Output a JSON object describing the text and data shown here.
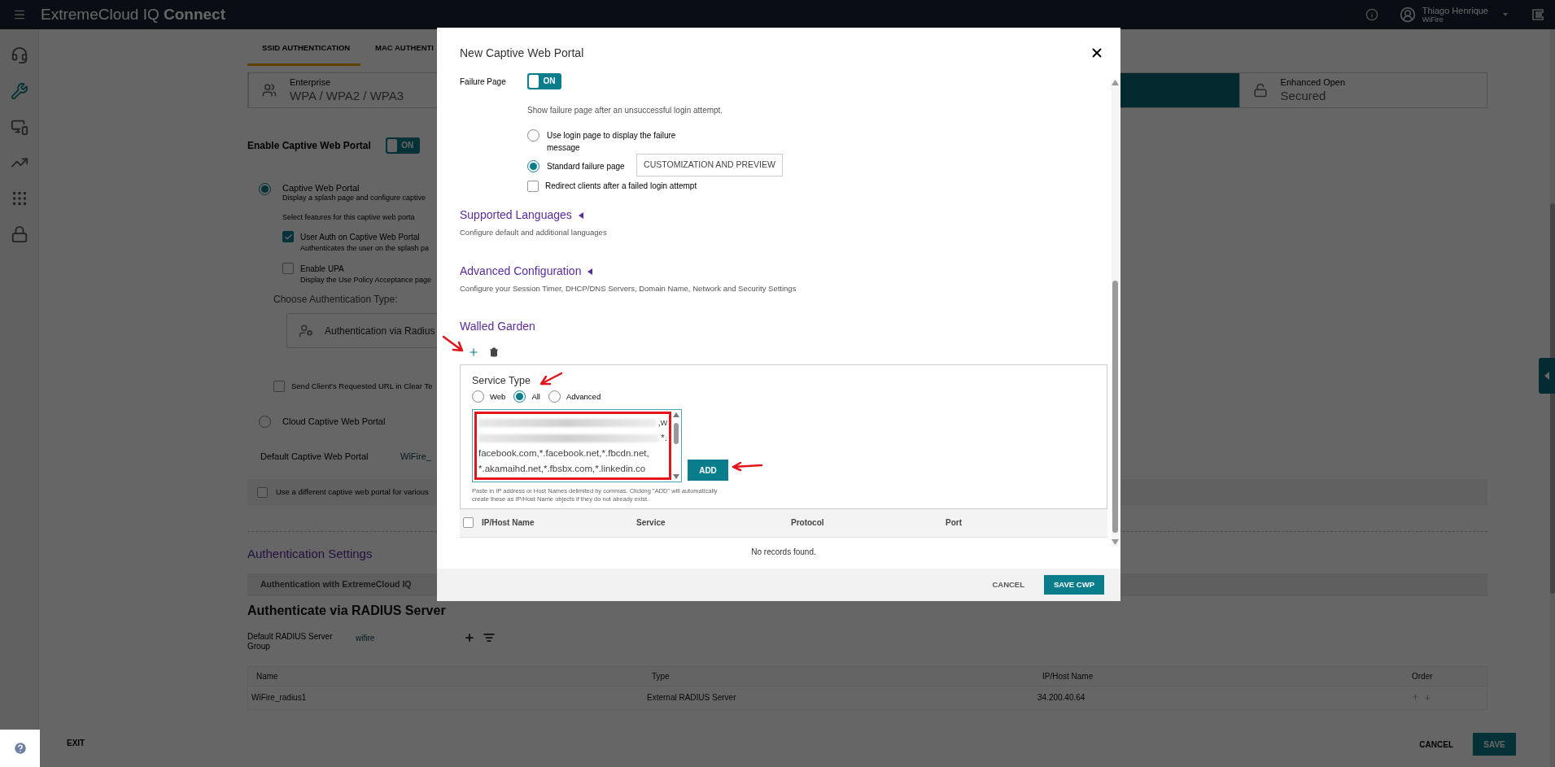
{
  "top_bar": {
    "brand": "ExtremeCloud IQ",
    "brand_bold": "Connect",
    "user_name": "Thiago Henrique",
    "user_org": "WiFire"
  },
  "sidebar": {
    "items": [
      {
        "selected": false
      },
      {
        "selected": true
      },
      {
        "selected": false
      },
      {
        "selected": false
      },
      {
        "selected": false
      },
      {
        "selected": false
      }
    ]
  },
  "tabs": [
    {
      "label": "SSID AUTHENTICATION",
      "selected": true
    },
    {
      "label": "MAC AUTHENTI",
      "selected": false
    }
  ],
  "auth_cards": [
    {
      "title": "Enterprise",
      "value": "WPA / WPA2 / WPA3",
      "selected": false
    },
    {
      "selected": true
    },
    {
      "title": "Enhanced Open",
      "value": "Secured",
      "selected": false
    }
  ],
  "captive_portal": {
    "label": "Enable Captive Web Portal",
    "toggle": {
      "label": "ON",
      "on": true
    },
    "portal_types": [
      {
        "label": "Captive Web Portal",
        "description": "Display a splash page and configure captive",
        "selected": true
      },
      {
        "label": "Cloud Captive Web Portal",
        "selected": false
      }
    ],
    "features_prompt": "Select features for this captive web porta",
    "features": [
      {
        "label": "User Auth on Captive Web Portal",
        "description": "Authenticates the user on the splash pa",
        "checked": true
      },
      {
        "label": "Enable UPA",
        "description": "Display the Use Policy Acceptance page",
        "checked": false
      }
    ],
    "auth_type_label": "Choose Authentication Type:",
    "auth_type_card": "Authentication via Radius",
    "send_url": {
      "label": "Send Client's Requested URL in Clear Te",
      "checked": false
    },
    "default_portal": {
      "label": "Default Captive Web Portal",
      "value": "WiFire_"
    },
    "different_portal": {
      "label": "Use a different captive web portal for various",
      "checked": false
    }
  },
  "auth_settings": {
    "title": "Authentication Settings",
    "bar": "Authentication with ExtremeCloud IQ",
    "heading": "Authenticate via RADIUS Server",
    "group_label": "Default RADIUS Server Group",
    "group_value": "wifire",
    "table": {
      "columns": [
        "Name",
        "Type",
        "IP/Host Name",
        "Order"
      ],
      "rows": [
        [
          "WiFire_radius1",
          "External RADIUS Server",
          "34.200.40.64"
        ]
      ]
    }
  },
  "footer": {
    "exit": "EXIT",
    "cancel": "CANCEL",
    "save": "SAVE"
  },
  "modal": {
    "title": "New Captive Web Portal",
    "failure_page": {
      "label": "Failure Page",
      "toggle": {
        "label": "ON",
        "on": true
      },
      "description": "Show failure page after an unsuccessful login attempt.",
      "options": [
        {
          "label": "Use login page to display the failure message",
          "selected": false
        },
        {
          "label": "Standard failure page",
          "selected": true
        }
      ],
      "customize_button": "CUSTOMIZATION AND PREVIEW",
      "redirect": {
        "label": "Redirect clients after a failed login attempt",
        "checked": false
      }
    },
    "sections": [
      {
        "title": "Supported Languages",
        "description": "Configure default and additional languages",
        "expanded": false
      },
      {
        "title": "Advanced Configuration",
        "description": "Configure your Session Timer, DHCP/DNS Servers, Domain Name, Network and Security Settings",
        "expanded": false
      }
    ],
    "walled_garden": {
      "title": "Walled Garden",
      "service_type_label": "Service Type",
      "service_types": [
        {
          "label": "Web",
          "selected": false
        },
        {
          "label": "All",
          "selected": true
        },
        {
          "label": "Advanced",
          "selected": false
        }
      ],
      "entry_lines": [
        {
          "redacted": true,
          "text": ",w"
        },
        {
          "redacted": true,
          "text": "*."
        },
        {
          "redacted": false,
          "text": "facebook.com,*.facebook.net,*.fbcdn.net,"
        },
        {
          "redacted": false,
          "text": "*.akamaihd.net,*.fbsbx.com,*.linkedin.co"
        }
      ],
      "add_button": "ADD",
      "hint": "Paste in IP address or Host Names delimited by commas. Clicking \"ADD\" will automatically create these as IP/Host Name objects if they do not already exist.",
      "table": {
        "columns": [
          "IP/Host Name",
          "Service",
          "Protocol",
          "Port"
        ],
        "empty": "No records found.",
        "all_checked": false
      }
    },
    "buttons": {
      "cancel": "CANCEL",
      "save": "SAVE CWP"
    }
  }
}
